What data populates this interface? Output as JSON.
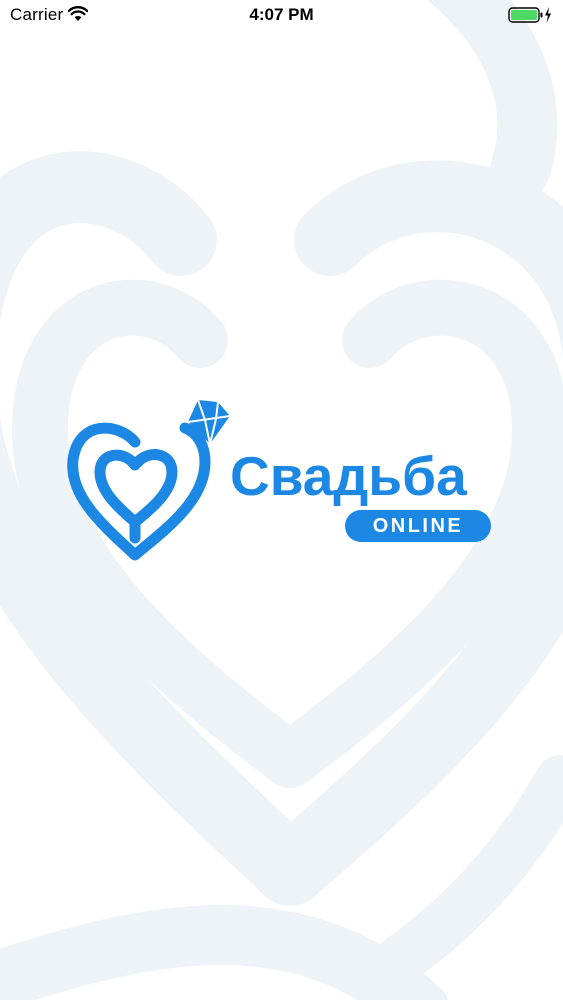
{
  "status_bar": {
    "carrier": "Carrier",
    "time": "4:07 PM",
    "wifi_icon": "wifi-icon",
    "battery_icon": "battery-charging-icon",
    "battery_color": "#4cd964"
  },
  "brand": {
    "title": "Свадьба",
    "badge": "ONLINE",
    "logo_icon": "heart-ring-diamond-icon",
    "accent_color": "#1c88e4"
  },
  "background": {
    "watermark_icon": "heart-watermark-icon",
    "watermark_color": "#eef3f7"
  }
}
